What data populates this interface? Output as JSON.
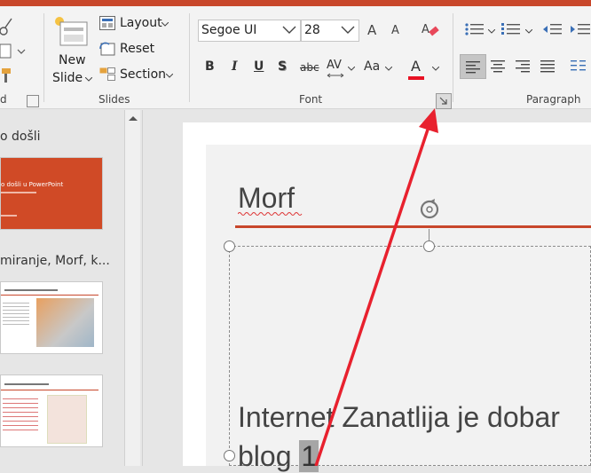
{
  "ribbon": {
    "clipboard": {
      "label": "d"
    },
    "slides": {
      "new_slide_line1": "New",
      "new_slide_line2": "Slide",
      "layout": "Layout",
      "reset": "Reset",
      "section": "Section",
      "label": "Slides"
    },
    "font": {
      "font_name": "Segoe UI",
      "font_size": "28",
      "bold": "B",
      "italic": "I",
      "underline": "U",
      "shadow": "S",
      "strike": "abc",
      "spacing": "AV",
      "case": "Aa",
      "color": "A",
      "grow": "A",
      "shrink": "A",
      "label": "Font",
      "color_hex": "#e81123"
    },
    "paragraph": {
      "label": "Paragraph"
    }
  },
  "thumbnails": [
    {
      "caption": "o došli",
      "title": "o došli u PowerPoint",
      "subtitle": ""
    },
    {
      "caption": "miranje, Morf, k...",
      "title": ""
    },
    {
      "caption": "",
      "title": ""
    }
  ],
  "slide": {
    "title": "Morf",
    "body_line1": "Internet Zanatlija je dobar",
    "body_line2": "blog",
    "body_highlight": "1"
  },
  "colors": {
    "accent": "#c8472b",
    "arrow": "#e8212e"
  }
}
